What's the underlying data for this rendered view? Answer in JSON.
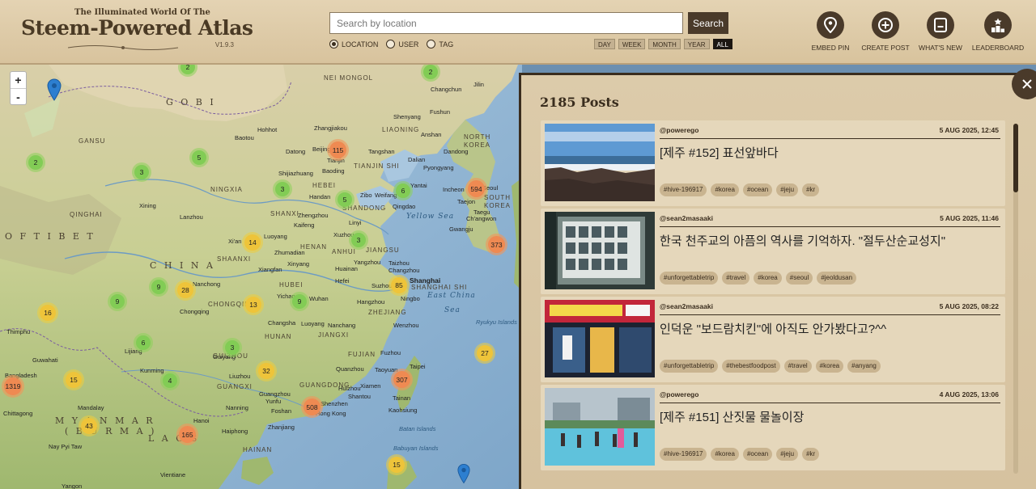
{
  "header": {
    "tagline": "The Illuminated World Of The",
    "title": "Steem-Powered Atlas",
    "version": "V1.9.3",
    "search_placeholder": "Search by location",
    "search_button": "Search",
    "search_modes": [
      {
        "label": "LOCATION",
        "checked": true
      },
      {
        "label": "USER",
        "checked": false
      },
      {
        "label": "TAG",
        "checked": false
      }
    ],
    "time_filters": [
      {
        "label": "DAY",
        "active": false
      },
      {
        "label": "WEEK",
        "active": false
      },
      {
        "label": "MONTH",
        "active": false
      },
      {
        "label": "YEAR",
        "active": false
      },
      {
        "label": "ALL",
        "active": true
      }
    ],
    "nav": [
      {
        "label": "EMBED PIN",
        "icon": "map-pin-icon"
      },
      {
        "label": "CREATE POST",
        "icon": "plus-circle-icon"
      },
      {
        "label": "WHAT'S NEW",
        "icon": "document-icon"
      },
      {
        "label": "LEADERBOARD",
        "icon": "leaderboard-icon"
      }
    ]
  },
  "map": {
    "zoom_in": "+",
    "zoom_out": "-",
    "labels": [
      {
        "text": "NEI MONGOL",
        "cls": "region"
      },
      {
        "text": "G O B I",
        "cls": "big"
      },
      {
        "text": "O F   T I B E T",
        "cls": "big"
      },
      {
        "text": "C H I N A",
        "cls": "big"
      },
      {
        "text": "M Y A N M A R",
        "cls": "big"
      },
      {
        "text": "( B U R M A )",
        "cls": "big"
      },
      {
        "text": "L A O S",
        "cls": "big"
      },
      {
        "text": "Yellow Sea",
        "cls": "sea"
      },
      {
        "text": "East China",
        "cls": "sea"
      },
      {
        "text": "Sea",
        "cls": "sea"
      },
      {
        "text": "NORTH",
        "cls": "region"
      },
      {
        "text": "KOREA",
        "cls": "region"
      },
      {
        "text": "SOUTH",
        "cls": "region"
      },
      {
        "text": "KOREA",
        "cls": "region"
      },
      {
        "text": "GANSU",
        "cls": "region"
      },
      {
        "text": "NINGXIA",
        "cls": "region"
      },
      {
        "text": "QINGHAI",
        "cls": "region"
      },
      {
        "text": "SHAANXI",
        "cls": "region"
      },
      {
        "text": "SHANXI",
        "cls": "region"
      },
      {
        "text": "HEBEI",
        "cls": "region"
      },
      {
        "text": "HENAN",
        "cls": "region"
      },
      {
        "text": "SHANDONG",
        "cls": "region"
      },
      {
        "text": "JIANGSU",
        "cls": "region"
      },
      {
        "text": "ANHUI",
        "cls": "region"
      },
      {
        "text": "HUBEI",
        "cls": "region"
      },
      {
        "text": "HUNAN",
        "cls": "region"
      },
      {
        "text": "JIANGXI",
        "cls": "region"
      },
      {
        "text": "ZHEJIANG",
        "cls": "region"
      },
      {
        "text": "FUJIAN",
        "cls": "region"
      },
      {
        "text": "GUANGDONG",
        "cls": "region"
      },
      {
        "text": "GUANGXI",
        "cls": "region"
      },
      {
        "text": "GUIZHOU",
        "cls": "region"
      },
      {
        "text": "CHONGQING",
        "cls": "region"
      },
      {
        "text": "LIAONING",
        "cls": "region"
      },
      {
        "text": "TIANJIN SHI",
        "cls": "region"
      },
      {
        "text": "SHANGHAI SHI",
        "cls": "region"
      },
      {
        "text": "HAINAN",
        "cls": "region"
      },
      {
        "text": "Ryukyu Islands",
        "cls": ""
      },
      {
        "text": "Batan Islands",
        "cls": ""
      },
      {
        "text": "Babuyan Islands",
        "cls": ""
      },
      {
        "text": "Hohhot",
        "cls": ""
      },
      {
        "text": "Baotou",
        "cls": ""
      },
      {
        "text": "Datong",
        "cls": ""
      },
      {
        "text": "Beijing",
        "cls": ""
      },
      {
        "text": "Tianjin",
        "cls": ""
      },
      {
        "text": "Tangshan",
        "cls": ""
      },
      {
        "text": "Shijiazhuang",
        "cls": ""
      },
      {
        "text": "Baoding",
        "cls": ""
      },
      {
        "text": "Handan",
        "cls": ""
      },
      {
        "text": "Zhengzhou",
        "cls": ""
      },
      {
        "text": "Kaifeng",
        "cls": ""
      },
      {
        "text": "Luoyang",
        "cls": ""
      },
      {
        "text": "Xi'an",
        "cls": ""
      },
      {
        "text": "Lanzhou",
        "cls": ""
      },
      {
        "text": "Xining",
        "cls": ""
      },
      {
        "text": "Zibo",
        "cls": ""
      },
      {
        "text": "Weifang",
        "cls": ""
      },
      {
        "text": "Qingdao",
        "cls": ""
      },
      {
        "text": "Yantai",
        "cls": ""
      },
      {
        "text": "Linyi",
        "cls": ""
      },
      {
        "text": "Xuzhou",
        "cls": ""
      },
      {
        "text": "Zhumadian",
        "cls": ""
      },
      {
        "text": "Xinyang",
        "cls": ""
      },
      {
        "text": "Xiangfan",
        "cls": ""
      },
      {
        "text": "Yangzhou",
        "cls": ""
      },
      {
        "text": "Huainan",
        "cls": ""
      },
      {
        "text": "Taizhou",
        "cls": ""
      },
      {
        "text": "Changzhou",
        "cls": ""
      },
      {
        "text": "Hefei",
        "cls": ""
      },
      {
        "text": "Suzhou",
        "cls": ""
      },
      {
        "text": "Shanghai",
        "cls": ""
      },
      {
        "text": "Ningbo",
        "cls": ""
      },
      {
        "text": "Hangzhou",
        "cls": ""
      },
      {
        "text": "Wuhan",
        "cls": ""
      },
      {
        "text": "Yichang",
        "cls": ""
      },
      {
        "text": "Chongqing",
        "cls": ""
      },
      {
        "text": "Nanchong",
        "cls": ""
      },
      {
        "text": "Changsha",
        "cls": ""
      },
      {
        "text": "Nanchang",
        "cls": ""
      },
      {
        "text": "Luoyang",
        "cls": ""
      },
      {
        "text": "Wenzhou",
        "cls": ""
      },
      {
        "text": "Fuzhou",
        "cls": ""
      },
      {
        "text": "Quanzhou",
        "cls": ""
      },
      {
        "text": "Xiamen",
        "cls": ""
      },
      {
        "text": "Shantou",
        "cls": ""
      },
      {
        "text": "Guangzhou",
        "cls": ""
      },
      {
        "text": "Shenzhen",
        "cls": ""
      },
      {
        "text": "Hong Kong",
        "cls": ""
      },
      {
        "text": "Foshan",
        "cls": ""
      },
      {
        "text": "Nanning",
        "cls": ""
      },
      {
        "text": "Zhanjiang",
        "cls": ""
      },
      {
        "text": "Liuzhou",
        "cls": ""
      },
      {
        "text": "Kunming",
        "cls": ""
      },
      {
        "text": "Guiyang",
        "cls": ""
      },
      {
        "text": "Haiphong",
        "cls": ""
      },
      {
        "text": "Hanoi",
        "cls": ""
      },
      {
        "text": "Vientiane",
        "cls": ""
      },
      {
        "text": "Mandalay",
        "cls": ""
      },
      {
        "text": "Nay Pyi Taw",
        "cls": ""
      },
      {
        "text": "Yangon",
        "cls": ""
      },
      {
        "text": "Taipei",
        "cls": ""
      },
      {
        "text": "Taoyuan",
        "cls": ""
      },
      {
        "text": "Tainan",
        "cls": ""
      },
      {
        "text": "Kaohsiung",
        "cls": ""
      },
      {
        "text": "Dalian",
        "cls": ""
      },
      {
        "text": "Pyongyang",
        "cls": ""
      },
      {
        "text": "Dandong",
        "cls": ""
      },
      {
        "text": "Anshan",
        "cls": ""
      },
      {
        "text": "Shenyang",
        "cls": ""
      },
      {
        "text": "Fushun",
        "cls": ""
      },
      {
        "text": "Changchun",
        "cls": ""
      },
      {
        "text": "Jilin",
        "cls": ""
      },
      {
        "text": "Zhangjiakou",
        "cls": ""
      },
      {
        "text": "Incheon",
        "cls": ""
      },
      {
        "text": "Seoul",
        "cls": ""
      },
      {
        "text": "Taejon",
        "cls": ""
      },
      {
        "text": "Taegu",
        "cls": ""
      },
      {
        "text": "Ch'angwon",
        "cls": ""
      },
      {
        "text": "Gwangju",
        "cls": ""
      },
      {
        "text": "Guwahati",
        "cls": ""
      },
      {
        "text": "Thimphu",
        "cls": ""
      },
      {
        "text": "Chittagong",
        "cls": ""
      },
      {
        "text": "Lijiang",
        "cls": ""
      },
      {
        "text": "Yunfu",
        "cls": ""
      },
      {
        "text": "Huizhou",
        "cls": ""
      },
      {
        "text": "Bangladesh",
        "cls": ""
      }
    ],
    "clusters": [
      {
        "count": "2",
        "color": "green"
      },
      {
        "count": "2",
        "color": "green"
      },
      {
        "count": "2",
        "color": "green"
      },
      {
        "count": "5",
        "color": "green"
      },
      {
        "count": "3",
        "color": "green"
      },
      {
        "count": "115",
        "color": "orange"
      },
      {
        "count": "3",
        "color": "green"
      },
      {
        "count": "5",
        "color": "green"
      },
      {
        "count": "6",
        "color": "green"
      },
      {
        "count": "594",
        "color": "orange"
      },
      {
        "count": "373",
        "color": "orange"
      },
      {
        "count": "3",
        "color": "green"
      },
      {
        "count": "14",
        "color": "yellow"
      },
      {
        "count": "9",
        "color": "green"
      },
      {
        "count": "28",
        "color": "yellow"
      },
      {
        "count": "85",
        "color": "yellow"
      },
      {
        "count": "9",
        "color": "green"
      },
      {
        "count": "9",
        "color": "green"
      },
      {
        "count": "13",
        "color": "yellow"
      },
      {
        "count": "16",
        "color": "yellow"
      },
      {
        "count": "6",
        "color": "green"
      },
      {
        "count": "3",
        "color": "green"
      },
      {
        "count": "27",
        "color": "yellow"
      },
      {
        "count": "32",
        "color": "yellow"
      },
      {
        "count": "15",
        "color": "yellow"
      },
      {
        "count": "4",
        "color": "green"
      },
      {
        "count": "307",
        "color": "orange"
      },
      {
        "count": "1319",
        "color": "orange"
      },
      {
        "count": "508",
        "color": "orange"
      },
      {
        "count": "43",
        "color": "yellow"
      },
      {
        "count": "165",
        "color": "orange"
      },
      {
        "count": "15",
        "color": "yellow"
      }
    ]
  },
  "panel": {
    "title": "2185 Posts",
    "posts": [
      {
        "user": "@powerego",
        "date": "5 AUG 2025, 12:45",
        "title": "[제주 #152] 표선앞바다",
        "tags": [
          "#hive-196917",
          "#korea",
          "#ocean",
          "#jeju",
          "#kr"
        ]
      },
      {
        "user": "@sean2masaaki",
        "date": "5 AUG 2025, 11:46",
        "title": "한국 천주교의 아픔의 역사를 기억하자. \"절두산순교성지\"",
        "tags": [
          "#unforgettabletrip",
          "#travel",
          "#korea",
          "#seoul",
          "#jeoldusan"
        ]
      },
      {
        "user": "@sean2masaaki",
        "date": "5 AUG 2025, 08:22",
        "title": "인덕운 \"보드람치킨\"에 아직도 안가봤다고?^^",
        "tags": [
          "#unforgettabletrip",
          "#thebestfoodpost",
          "#travel",
          "#korea",
          "#anyang"
        ]
      },
      {
        "user": "@powerego",
        "date": "4 AUG 2025, 13:06",
        "title": "[제주 #151] 산짓물 물놀이장",
        "tags": [
          "#hive-196917",
          "#korea",
          "#ocean",
          "#jeju",
          "#kr"
        ]
      }
    ]
  }
}
